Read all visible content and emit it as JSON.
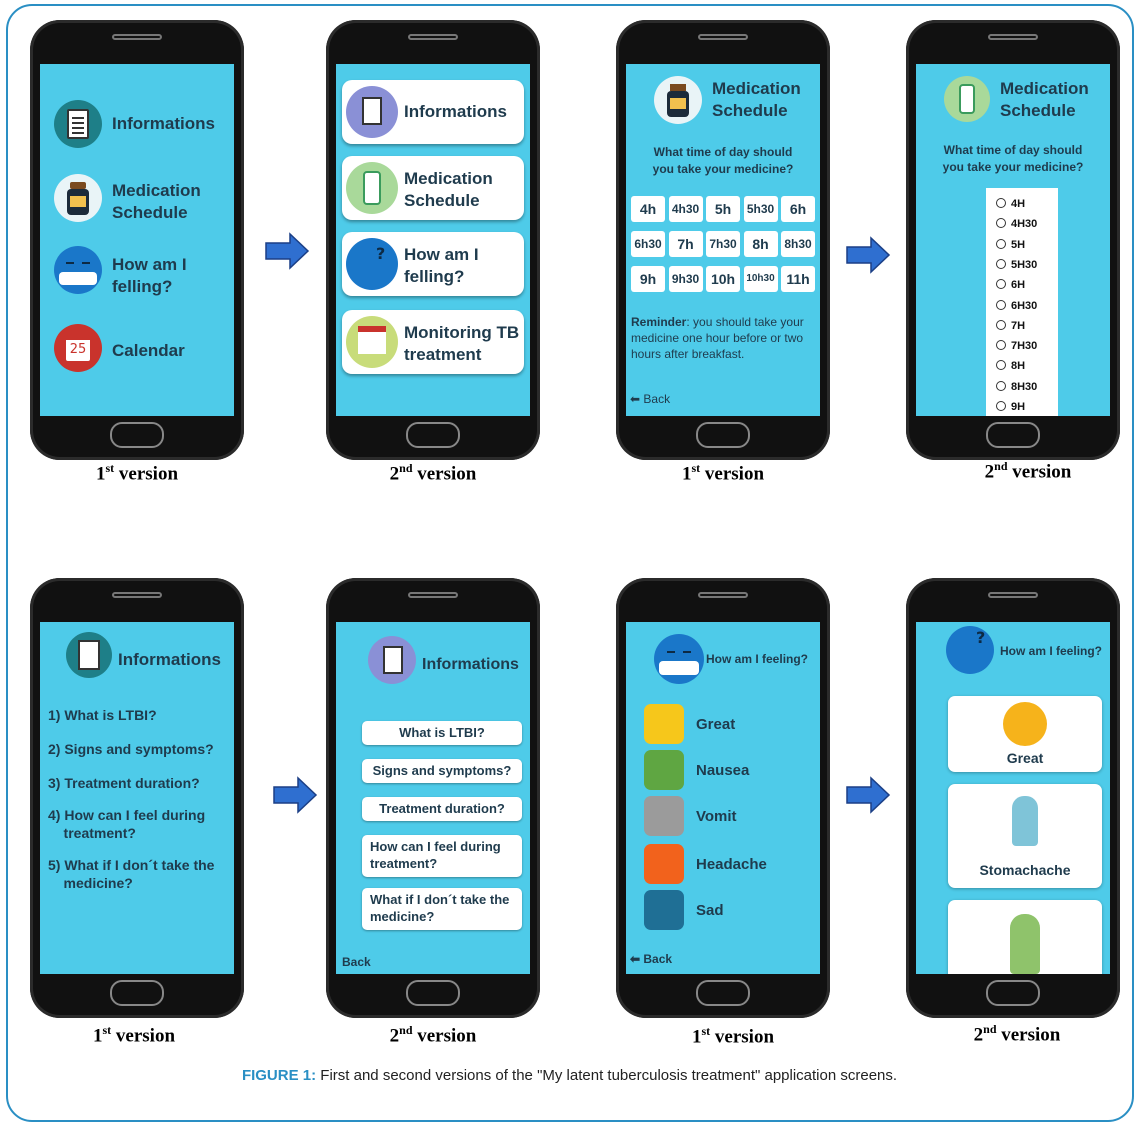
{
  "caption_v1": "1",
  "caption_v2": "2",
  "sup_st": "st",
  "sup_nd": "nd",
  "caption_word": "version",
  "figure": {
    "label": "FIGURE 1:",
    "text": "First and second versions of the \"My latent tuberculosis treatment\" application screens."
  },
  "home_v1": {
    "items": [
      "Informations",
      "Medication\nSchedule",
      "How am I\nfelling?",
      "Calendar"
    ],
    "calendar_day": "25"
  },
  "home_v2": {
    "items": [
      "Informations",
      "Medication\nSchedule",
      "How am I\nfelling?",
      "Monitoring TB\ntreatment"
    ]
  },
  "med_v1": {
    "title": "Medication\nSchedule",
    "question": "What time of day should\nyou take your medicine?",
    "times": [
      [
        "4h",
        "4h30",
        "5h",
        "5h30",
        "6h"
      ],
      [
        "6h30",
        "7h",
        "7h30",
        "8h",
        "8h30"
      ],
      [
        "9h",
        "9h30",
        "10h",
        "10h30",
        "11h"
      ]
    ],
    "reminder_label": "Reminder",
    "reminder_text": ": you should take your medicine one hour before or two hours after breakfast.",
    "back": "Back"
  },
  "med_v2": {
    "title": "Medication\nSchedule",
    "question": "What time of day should\nyou take your medicine?",
    "options": [
      "4H",
      "4H30",
      "5H",
      "5H30",
      "6H",
      "6H30",
      "7H",
      "7H30",
      "8H",
      "8H30",
      "9H"
    ]
  },
  "info_v1": {
    "title": "Informations",
    "items": [
      "1) What is LTBI?",
      "2) Signs and symptoms?",
      "3) Treatment duration?",
      "4) How can I feel during\n    treatment?",
      "5) What if I don´t take the\n    medicine?"
    ]
  },
  "info_v2": {
    "title": "Informations",
    "items": [
      "What is LTBI?",
      "Signs and symptoms?",
      "Treatment duration?",
      "How can I feel during\ntreatment?",
      "What if I don´t take the\nmedicine?"
    ],
    "back": "Back"
  },
  "feel_v1": {
    "title": "How am I feeling?",
    "items": [
      "Great",
      "Nausea",
      "Vomit",
      "Headache",
      "Sad"
    ],
    "back": "Back"
  },
  "feel_v2": {
    "title": "How am I feeling?",
    "items": [
      "Great",
      "Stomachache"
    ]
  },
  "colors": {
    "screen": "#4ecbe9",
    "accent": "#2a8fc4",
    "arrow": "#2f6fd0"
  }
}
